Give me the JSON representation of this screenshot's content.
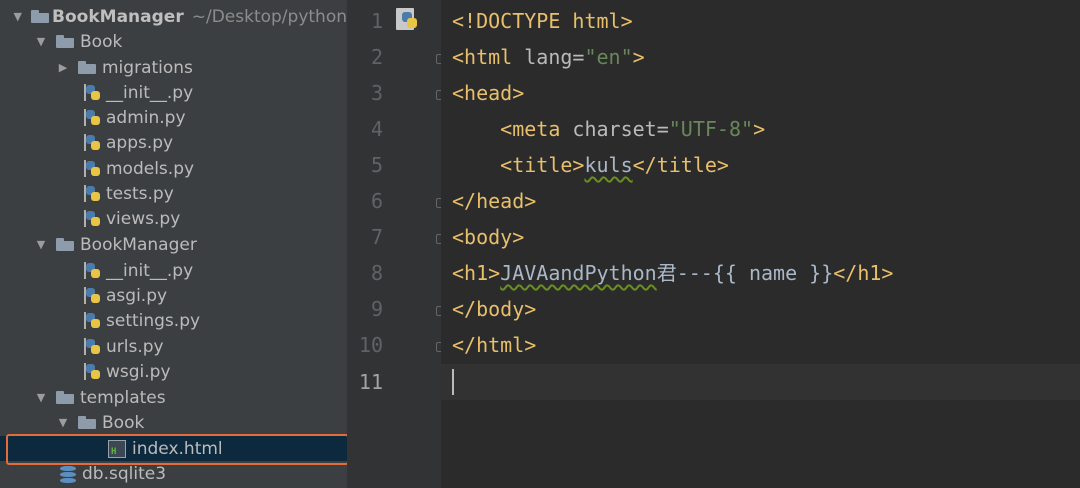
{
  "project_tree": {
    "root": {
      "label": "BookManager",
      "path": "~/Desktop/python"
    },
    "items": [
      {
        "label": "Book",
        "type": "folder",
        "expanded": true
      },
      {
        "label": "migrations",
        "type": "folder",
        "expanded": false
      },
      {
        "label": "__init__.py",
        "type": "python-file"
      },
      {
        "label": "admin.py",
        "type": "python-file"
      },
      {
        "label": "apps.py",
        "type": "python-file"
      },
      {
        "label": "models.py",
        "type": "python-file"
      },
      {
        "label": "tests.py",
        "type": "python-file"
      },
      {
        "label": "views.py",
        "type": "python-file"
      },
      {
        "label": "BookManager",
        "type": "folder",
        "expanded": true
      },
      {
        "label": "__init__.py",
        "type": "python-file"
      },
      {
        "label": "asgi.py",
        "type": "python-file"
      },
      {
        "label": "settings.py",
        "type": "python-file"
      },
      {
        "label": "urls.py",
        "type": "python-file"
      },
      {
        "label": "wsgi.py",
        "type": "python-file"
      },
      {
        "label": "templates",
        "type": "folder",
        "expanded": true
      },
      {
        "label": "Book",
        "type": "folder",
        "expanded": true
      },
      {
        "label": "index.html",
        "type": "html-file",
        "selected": true
      },
      {
        "label": "db.sqlite3",
        "type": "database-file"
      }
    ]
  },
  "editor": {
    "line_numbers": [
      "1",
      "2",
      "3",
      "4",
      "5",
      "6",
      "7",
      "8",
      "9",
      "10",
      "11"
    ],
    "current_line": "11",
    "lines": {
      "l1": {
        "a": "<!DOCTYPE html>"
      },
      "l2": {
        "a": "<html",
        "b": " lang=",
        "c": "\"en\"",
        "d": ">"
      },
      "l3": {
        "a": "<head>"
      },
      "l4": {
        "indent": "    ",
        "a": "<meta",
        "b": " charset=",
        "c": "\"UTF-8\"",
        "d": ">"
      },
      "l5": {
        "indent": "    ",
        "a": "<title>",
        "b": "kuls",
        "c": "</title>"
      },
      "l6": {
        "a": "</head>"
      },
      "l7": {
        "a": "<body>"
      },
      "l8": {
        "a": "<h1>",
        "b": "JAVAandPython",
        "c": "君---{{ name }}",
        "d": "</h1>"
      },
      "l9": {
        "a": "</body>"
      },
      "l10": {
        "a": "</html>"
      }
    }
  },
  "colors": {
    "tree_background": "#3c3f41",
    "editor_background": "#2b2b2b",
    "gutter_background": "#313335",
    "tag": "#e8bf6a",
    "attribute": "#bababa",
    "string": "#6a8759",
    "text": "#a9b7c6",
    "selection_outline": "#e46b3b",
    "selected_row": "#0d293e"
  },
  "icons": {
    "file_type_badge": "python-logo-icon",
    "folder": "folder-icon",
    "python_file": "python-file-icon",
    "html_file": "html-file-icon",
    "database_file": "database-icon"
  }
}
